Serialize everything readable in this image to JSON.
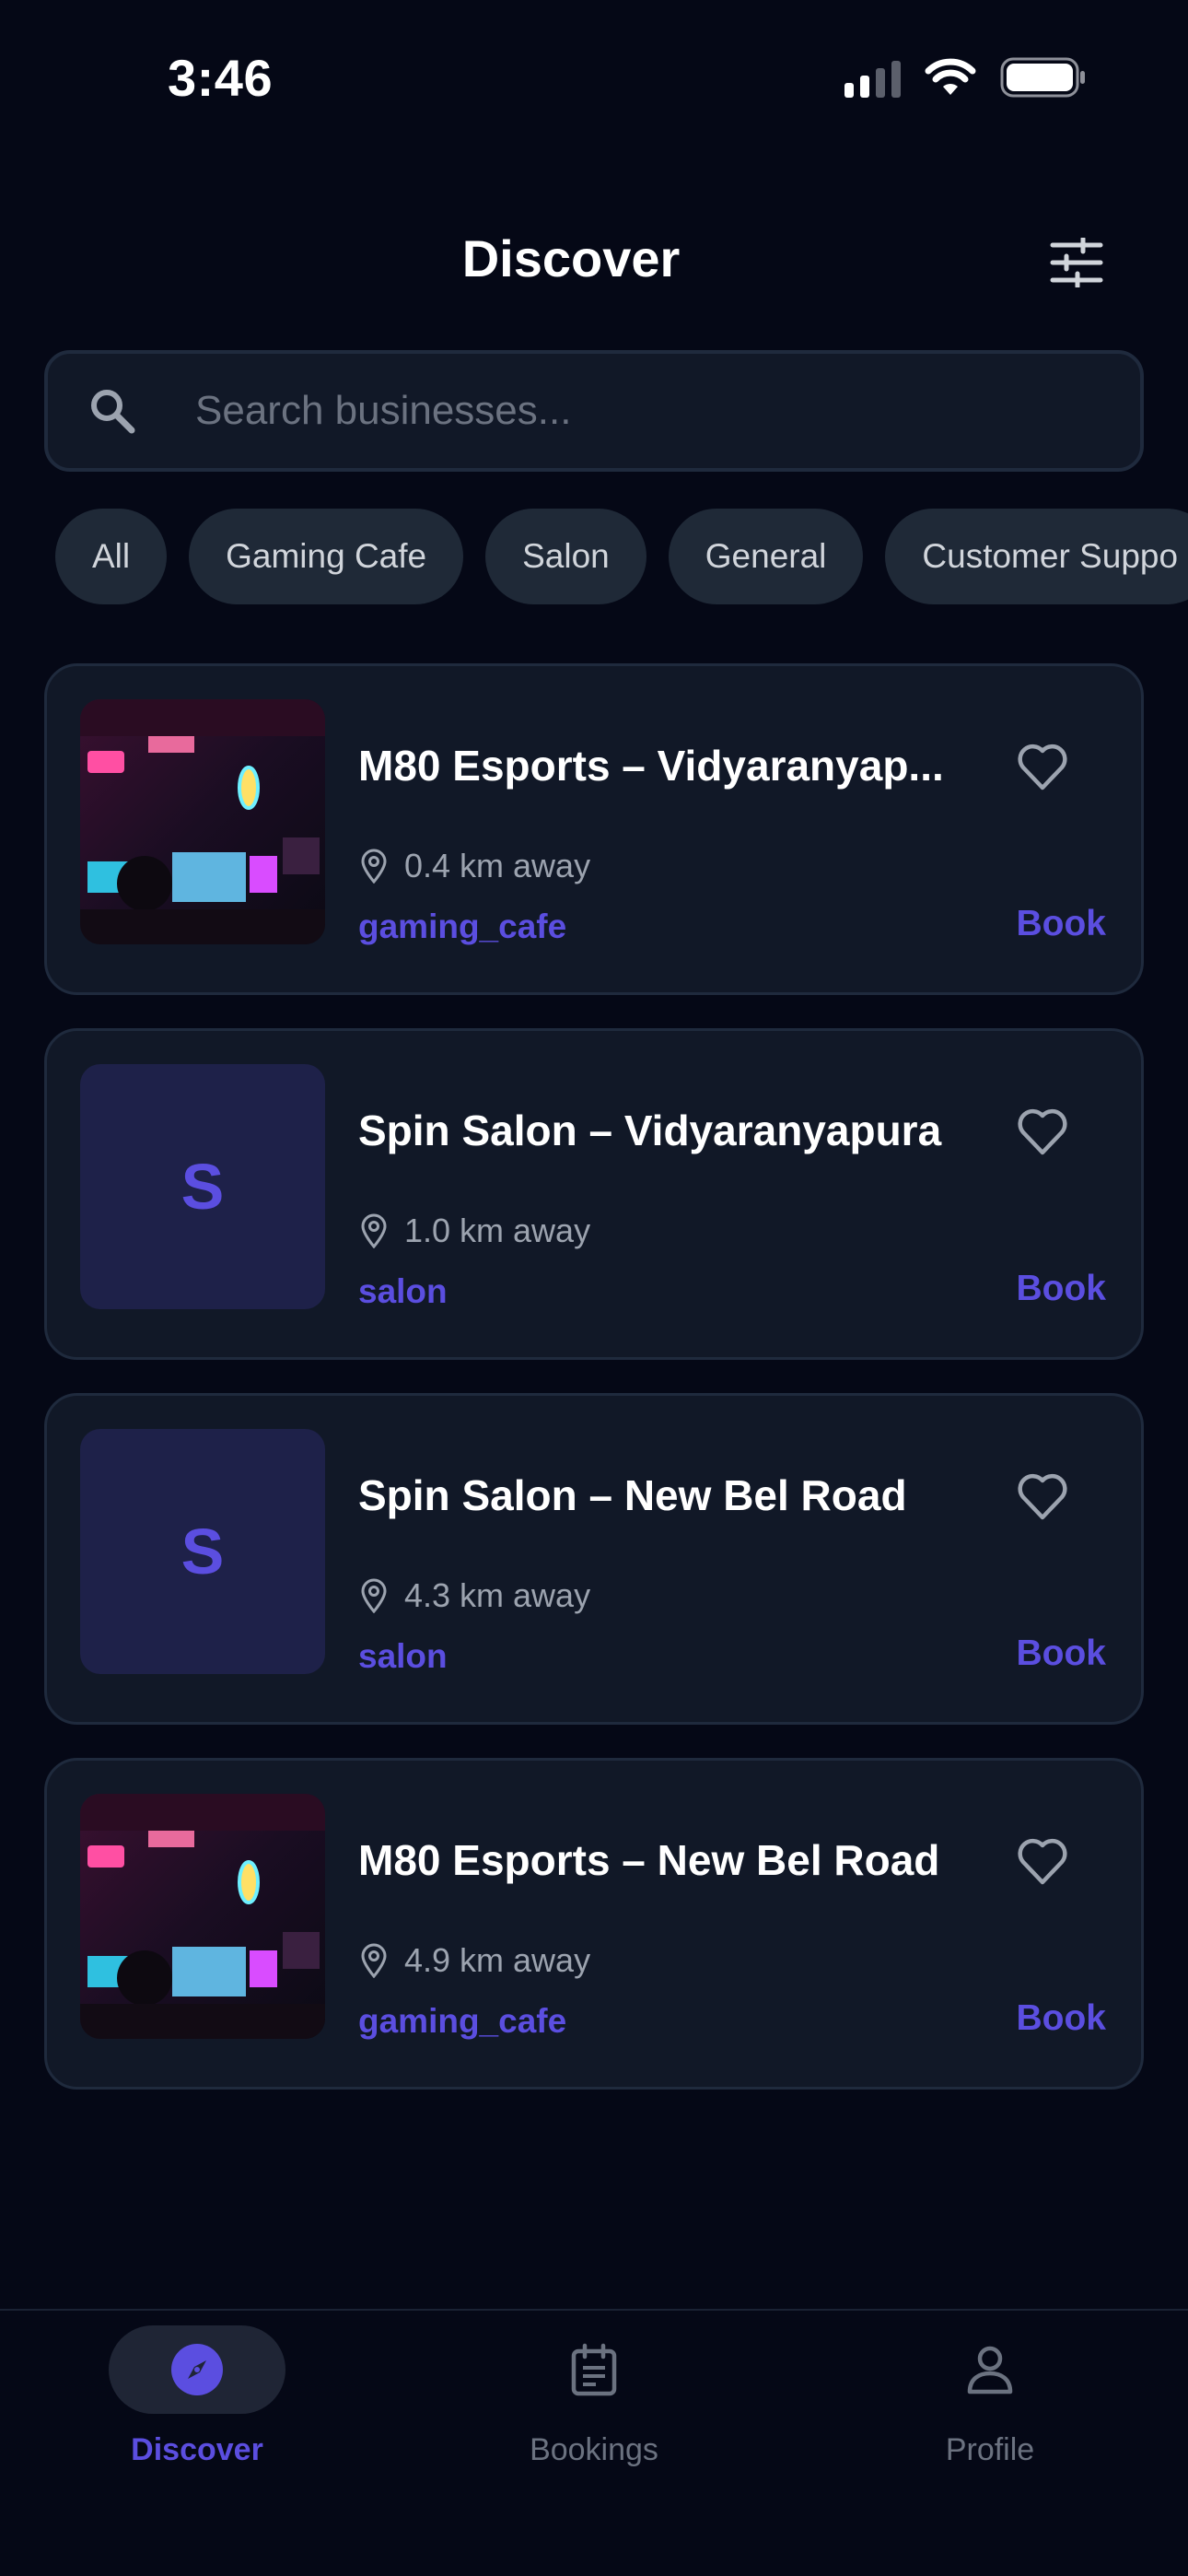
{
  "status_bar": {
    "time": "3:46"
  },
  "header": {
    "title": "Discover"
  },
  "search": {
    "placeholder": "Search businesses..."
  },
  "chips": [
    "All",
    "Gaming Cafe",
    "Salon",
    "General",
    "Customer Suppo"
  ],
  "businesses": [
    {
      "name": "M80 Esports – Vidyaranyap...",
      "distance": "0.4 km away",
      "category": "gaming_cafe",
      "action": "Book",
      "thumbnail": "photo"
    },
    {
      "name": "Spin Salon – Vidyaranyapura",
      "distance": "1.0 km away",
      "category": "salon",
      "action": "Book",
      "thumbnail": "letter",
      "letter": "S"
    },
    {
      "name": "Spin Salon – New Bel Road",
      "distance": "4.3 km away",
      "category": "salon",
      "action": "Book",
      "thumbnail": "letter",
      "letter": "S"
    },
    {
      "name": "M80 Esports – New Bel Road",
      "distance": "4.9 km away",
      "category": "gaming_cafe",
      "action": "Book",
      "thumbnail": "photo"
    }
  ],
  "nav": [
    {
      "label": "Discover",
      "icon": "compass-icon",
      "active": true
    },
    {
      "label": "Bookings",
      "icon": "calendar-icon",
      "active": false
    },
    {
      "label": "Profile",
      "icon": "user-icon",
      "active": false
    }
  ],
  "colors": {
    "background": "#050816",
    "card": "#111827",
    "accent": "#5b4ee0",
    "muted": "#9ca3af"
  }
}
